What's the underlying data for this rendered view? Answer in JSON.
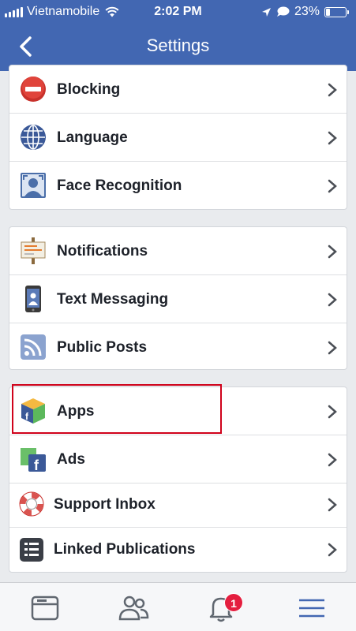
{
  "status_bar": {
    "carrier": "Vietnamobile",
    "time": "2:02 PM",
    "battery": "23%",
    "battery_level": 0.23
  },
  "header": {
    "title": "Settings"
  },
  "groups": [
    {
      "items": [
        {
          "label": "Blocking",
          "icon": "blocking-icon"
        },
        {
          "label": "Language",
          "icon": "globe-icon"
        },
        {
          "label": "Face Recognition",
          "icon": "face-recognition-icon"
        }
      ]
    },
    {
      "items": [
        {
          "label": "Notifications",
          "icon": "notifications-icon"
        },
        {
          "label": "Text Messaging",
          "icon": "phone-icon"
        },
        {
          "label": "Public Posts",
          "icon": "rss-icon"
        }
      ]
    },
    {
      "items": [
        {
          "label": "Apps",
          "icon": "apps-cube-icon"
        },
        {
          "label": "Ads",
          "icon": "ads-icon"
        },
        {
          "label": "Support Inbox",
          "icon": "lifebuoy-icon"
        },
        {
          "label": "Linked Publications",
          "icon": "publications-icon"
        }
      ]
    }
  ],
  "tab_bar": {
    "tabs": [
      "news-feed-icon",
      "friends-icon",
      "bell-icon",
      "menu-icon"
    ],
    "notification_badge": "1",
    "active_tab": "menu-icon"
  },
  "colors": {
    "header": "#4267b2",
    "highlight": "#d0021b",
    "badge": "#e41e3f",
    "active_tab": "#4267b2"
  }
}
